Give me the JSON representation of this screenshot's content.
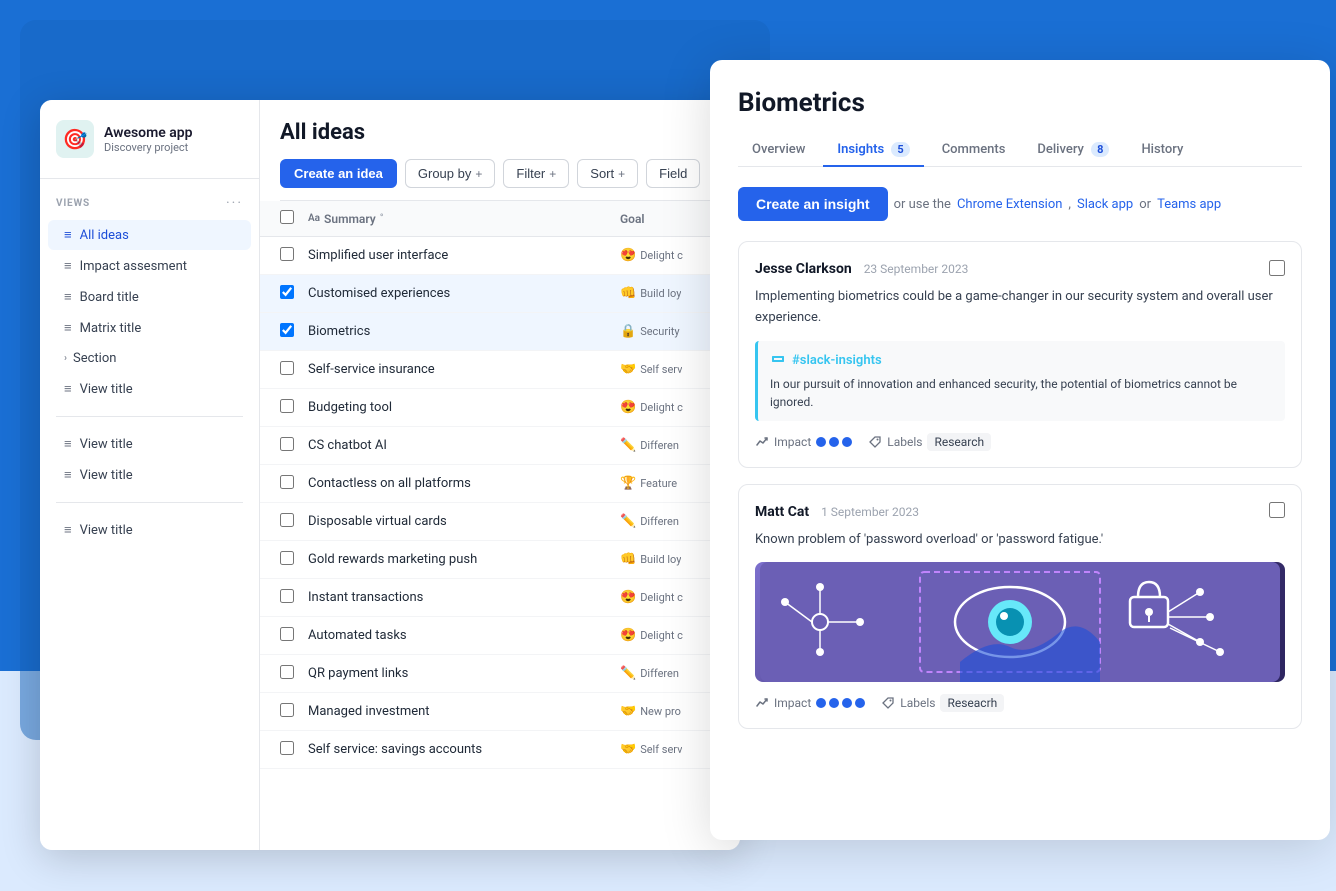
{
  "app": {
    "icon": "🎯",
    "title": "Awesome app",
    "subtitle": "Discovery project"
  },
  "sidebar": {
    "views_label": "VIEWS",
    "menu_dots": "···",
    "items": [
      {
        "id": "all-ideas",
        "label": "All ideas",
        "icon": "≡",
        "active": true
      },
      {
        "id": "impact-assessment",
        "label": "Impact assesment",
        "icon": "≡",
        "active": false
      },
      {
        "id": "board-title",
        "label": "Board title",
        "icon": "≡",
        "active": false
      },
      {
        "id": "matrix-title",
        "label": "Matrix title",
        "icon": "≡",
        "active": false
      },
      {
        "id": "section",
        "label": "Section",
        "icon": "›",
        "active": false
      },
      {
        "id": "view-title-1",
        "label": "View title",
        "icon": "≡",
        "active": false
      }
    ],
    "items2": [
      {
        "id": "view-title-2",
        "label": "View title",
        "icon": "≡",
        "active": false
      },
      {
        "id": "view-title-3",
        "label": "View title",
        "icon": "≡",
        "active": false
      }
    ],
    "items3": [
      {
        "id": "view-title-4",
        "label": "View title",
        "icon": "≡",
        "active": false
      }
    ]
  },
  "main": {
    "title": "All ideas",
    "toolbar": {
      "create_label": "Create an idea",
      "group_by_label": "Group by",
      "filter_label": "Filter",
      "sort_label": "Sort",
      "fields_label": "Field"
    },
    "table": {
      "col_summary": "Summary",
      "col_goal": "Goal",
      "rows": [
        {
          "id": 1,
          "summary": "Simplified user interface",
          "goal_emoji": "😍",
          "goal_text": "Delight c"
        },
        {
          "id": 2,
          "summary": "Customised experiences",
          "goal_emoji": "👊",
          "goal_text": "Build loy",
          "selected": true
        },
        {
          "id": 3,
          "summary": "Biometrics",
          "goal_emoji": "🔒",
          "goal_text": "Security",
          "selected": true
        },
        {
          "id": 4,
          "summary": "Self-service insurance",
          "goal_emoji": "🤝",
          "goal_text": "Self serv"
        },
        {
          "id": 5,
          "summary": "Budgeting tool",
          "goal_emoji": "😍",
          "goal_text": "Delight c"
        },
        {
          "id": 6,
          "summary": "CS chatbot AI",
          "goal_emoji": "✏️",
          "goal_text": "Differen"
        },
        {
          "id": 7,
          "summary": "Contactless on all platforms",
          "goal_emoji": "🏆",
          "goal_text": "Feature"
        },
        {
          "id": 8,
          "summary": "Disposable virtual cards",
          "goal_emoji": "✏️",
          "goal_text": "Differen"
        },
        {
          "id": 9,
          "summary": "Gold rewards marketing push",
          "goal_emoji": "👊",
          "goal_text": "Build loy"
        },
        {
          "id": 10,
          "summary": "Instant transactions",
          "goal_emoji": "😍",
          "goal_text": "Delight c"
        },
        {
          "id": 11,
          "summary": "Automated tasks",
          "goal_emoji": "😍",
          "goal_text": "Delight c"
        },
        {
          "id": 12,
          "summary": "QR payment links",
          "goal_emoji": "✏️",
          "goal_text": "Differen"
        },
        {
          "id": 13,
          "summary": "Managed investment",
          "goal_emoji": "🤝",
          "goal_text": "New pro"
        },
        {
          "id": 14,
          "summary": "Self service: savings accounts",
          "goal_emoji": "🤝",
          "goal_text": "Self serv"
        }
      ]
    }
  },
  "detail": {
    "title": "Biometrics",
    "tabs": [
      {
        "id": "overview",
        "label": "Overview",
        "active": false
      },
      {
        "id": "insights",
        "label": "Insights",
        "badge": "5",
        "active": true
      },
      {
        "id": "comments",
        "label": "Comments",
        "active": false
      },
      {
        "id": "delivery",
        "label": "Delivery",
        "badge": "8",
        "active": false
      },
      {
        "id": "history",
        "label": "History",
        "active": false
      }
    ],
    "create_insight_label": "Create an insight",
    "hint_text": "or use the",
    "hint_links": [
      "Chrome Extension",
      "Slack app",
      "Teams app"
    ],
    "hint_connector1": ", ",
    "hint_connector2": " or ",
    "insights": [
      {
        "id": 1,
        "author": "Jesse Clarkson",
        "date": "23 September 2023",
        "body": "Implementing biometrics could be a game-changer in our security system and overall user experience.",
        "slack_channel": "#slack-insights",
        "slack_text": "In our pursuit of innovation and enhanced security, the potential of biometrics cannot be ignored.",
        "impact_dots": 3,
        "labels_text": "Labels",
        "labels_value": "Research"
      },
      {
        "id": 2,
        "author": "Matt Cat",
        "date": "1 September 2023",
        "body": "Known problem of 'password overload' or 'password fatigue.'",
        "has_image": true,
        "impact_dots": 4,
        "labels_text": "Labels",
        "labels_value": "Reseacrh"
      }
    ]
  }
}
